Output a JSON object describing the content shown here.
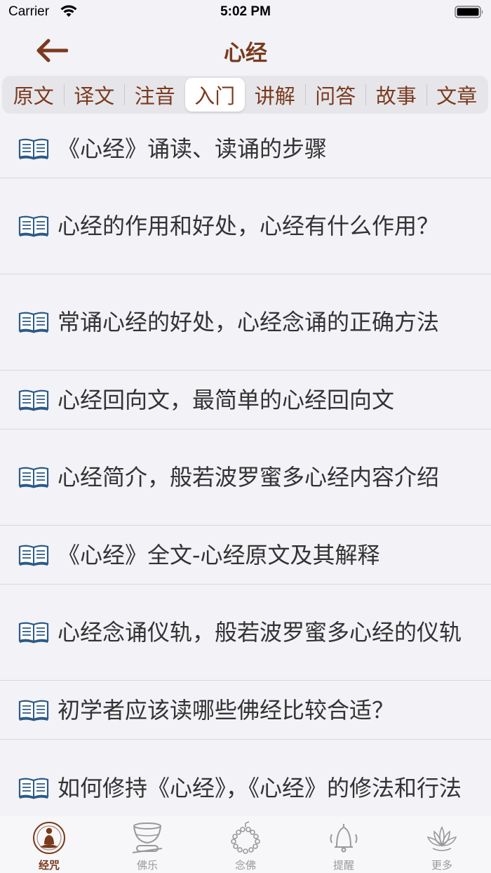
{
  "status_bar": {
    "carrier": "Carrier",
    "time": "5:02 PM"
  },
  "nav": {
    "title": "心经",
    "back_icon": "arrow-left-icon"
  },
  "tabs": [
    {
      "label": "原文",
      "active": false
    },
    {
      "label": "译文",
      "active": false
    },
    {
      "label": "注音",
      "active": false
    },
    {
      "label": "入门",
      "active": true
    },
    {
      "label": "讲解",
      "active": false
    },
    {
      "label": "问答",
      "active": false
    },
    {
      "label": "故事",
      "active": false
    },
    {
      "label": "文章",
      "active": false
    }
  ],
  "list": {
    "icon": "open-book-icon",
    "items": [
      {
        "text": "《心经》诵读、读诵的步骤"
      },
      {
        "text": "心经的作用和好处，心经有什么作用？"
      },
      {
        "text": "常诵心经的好处，心经念诵的正确方法"
      },
      {
        "text": "心经回向文，最简单的心经回向文"
      },
      {
        "text": "心经简介，般若波罗蜜多心经内容介绍"
      },
      {
        "text": "《心经》全文-心经原文及其解释"
      },
      {
        "text": "心经念诵仪轨，般若波罗蜜多心经的仪轨"
      },
      {
        "text": "初学者应该读哪些佛经比较合适？"
      },
      {
        "text": "如何修持《心经》，《心经》的修法和行法"
      }
    ]
  },
  "tab_bar": {
    "items": [
      {
        "label": "经咒",
        "icon": "buddha-icon",
        "active": true
      },
      {
        "label": "佛乐",
        "icon": "singing-bowl-icon",
        "active": false
      },
      {
        "label": "念佛",
        "icon": "prayer-beads-icon",
        "active": false
      },
      {
        "label": "提醒",
        "icon": "bell-icon",
        "active": false
      },
      {
        "label": "更多",
        "icon": "lotus-icon",
        "active": false
      }
    ]
  },
  "colors": {
    "accent": "#7a3a1e",
    "background": "#f2f2f7",
    "icon_blue": "#2b5a87"
  }
}
